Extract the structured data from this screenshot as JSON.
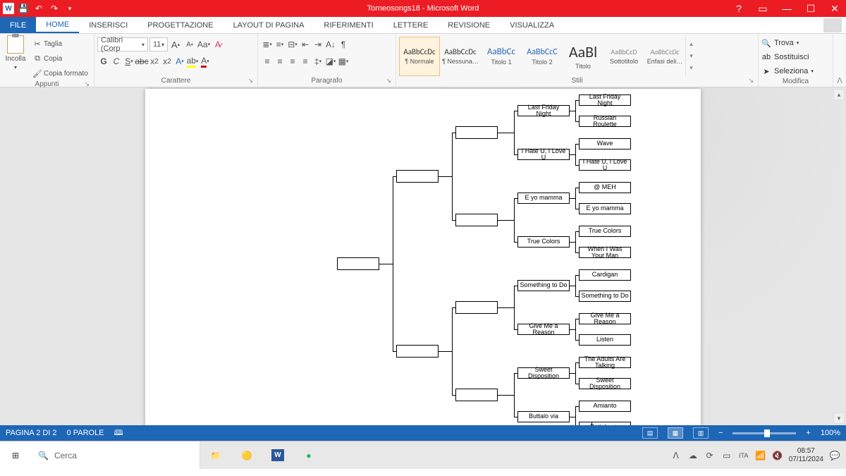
{
  "titlebar": {
    "doc": "Torneosongs18",
    "app": "Microsoft Word"
  },
  "tabs": {
    "file": "FILE",
    "items": [
      "HOME",
      "INSERISCI",
      "PROGETTAZIONE",
      "LAYOUT DI PAGINA",
      "RIFERIMENTI",
      "LETTERE",
      "REVISIONE",
      "VISUALIZZA"
    ],
    "active": 0
  },
  "ribbon": {
    "clipboard": {
      "paste": "Incolla",
      "cut": "Taglia",
      "copy": "Copia",
      "fmt": "Copia formato",
      "label": "Appunti"
    },
    "font": {
      "name": "Calibri (Corp",
      "size": "11",
      "label": "Carattere"
    },
    "para": {
      "label": "Paragrafo"
    },
    "styles": {
      "items": [
        {
          "prev": "AaBbCcDc",
          "name": "¶ Normale",
          "sel": true,
          "fs": "11px",
          "col": "#333"
        },
        {
          "prev": "AaBbCcDc",
          "name": "¶ Nessuna…",
          "fs": "11px",
          "col": "#333"
        },
        {
          "prev": "AaBbCc",
          "name": "Titolo 1",
          "fs": "13px",
          "col": "#2a6ab8"
        },
        {
          "prev": "AaBbCcC",
          "name": "Titolo 2",
          "fs": "12px",
          "col": "#2a6ab8"
        },
        {
          "prev": "AaBl",
          "name": "Titolo",
          "fs": "22px",
          "col": "#333"
        },
        {
          "prev": "AaBbCcD",
          "name": "Sottotitolo",
          "fs": "10px",
          "col": "#888"
        },
        {
          "prev": "AaBbCcDc",
          "name": "Enfasi deli…",
          "fs": "10px",
          "col": "#888",
          "it": true
        }
      ],
      "label": "Stili"
    },
    "editing": {
      "find": "Trova",
      "replace": "Sostituisci",
      "select": "Seleziona",
      "label": "Modifica"
    }
  },
  "bracket": {
    "r16": [
      "Last Friday Night",
      "Russian Roulette",
      "Wave",
      "I Hate U, I Love U",
      "@ MEH",
      "E yo mamma",
      "True Colors",
      "When I Was Your Man",
      "Cardigan",
      "Something to Do",
      "Give Me a Reason",
      "Listen",
      "The Adults Are Talking",
      "Sweet Disposition",
      "Amianto",
      "Buttalo via"
    ],
    "r8": [
      "Last Friday Night",
      "I Hate U, I Love U",
      "E yo mamma",
      "True Colors",
      "Something to Do",
      "Give Me a Reason",
      "Sweet Disposition",
      "Buttalo via"
    ]
  },
  "status": {
    "page": "PAGINA 2 DI 2",
    "words": "0 PAROLE",
    "zoom": "100%"
  },
  "taskbar": {
    "search": "Cerca",
    "time": "08:57",
    "date": "07/11/2024"
  }
}
